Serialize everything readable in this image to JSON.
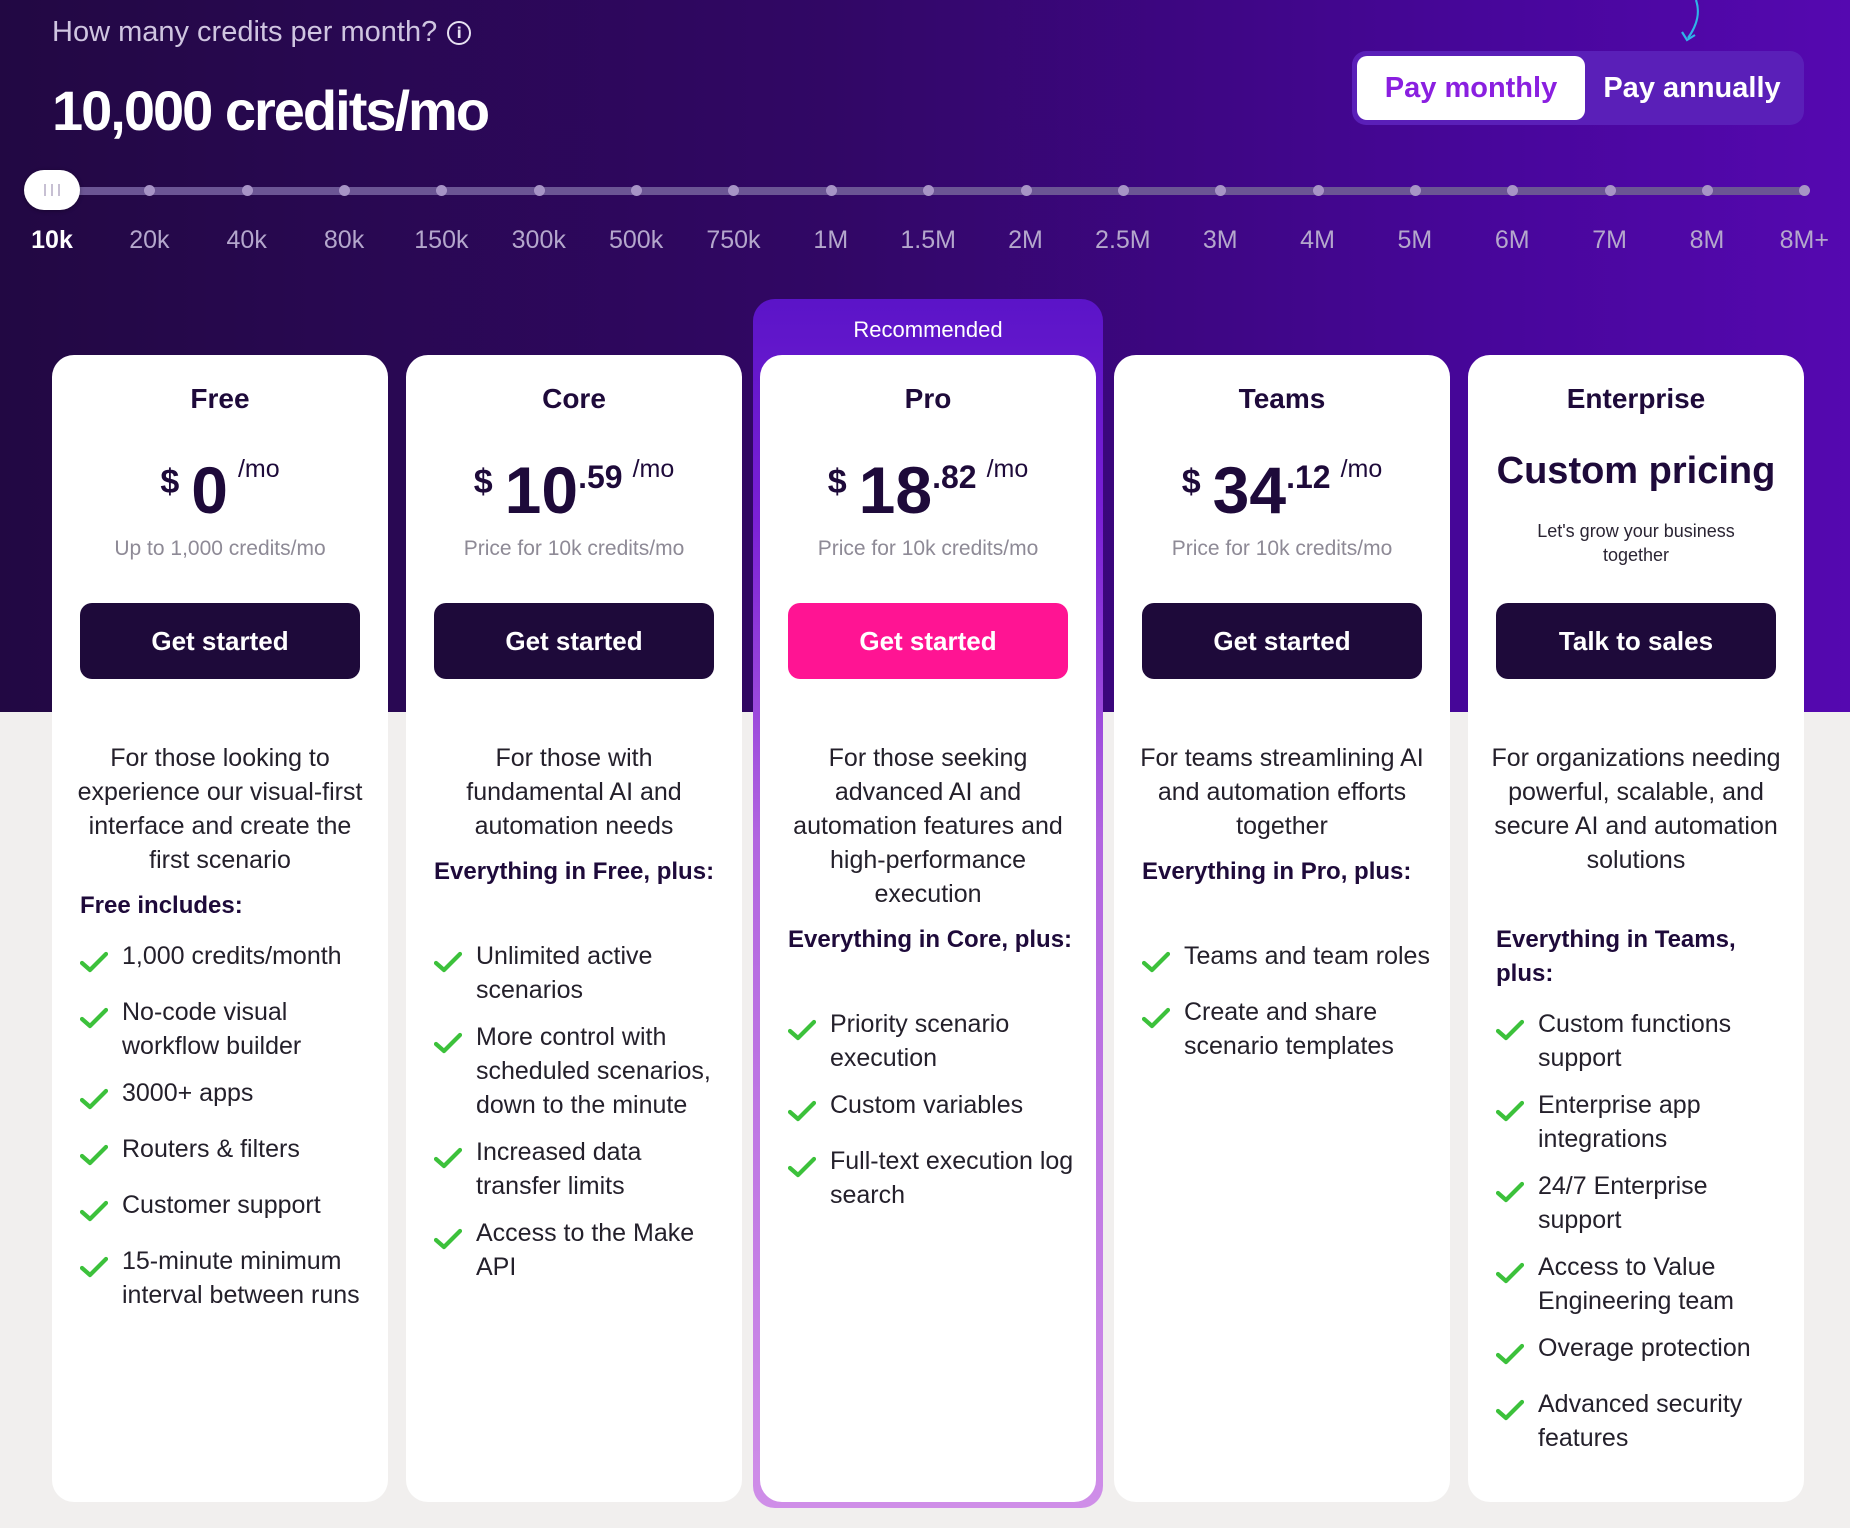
{
  "header": {
    "question": "How many credits per month?",
    "info_icon": "info-circle-icon",
    "selected_value": "10,000 credits/mo"
  },
  "billing": {
    "monthly_label": "Pay monthly",
    "annual_label": "Pay annually",
    "selected": "monthly"
  },
  "slider": {
    "labels": [
      "10k",
      "20k",
      "40k",
      "80k",
      "150k",
      "300k",
      "500k",
      "750k",
      "1M",
      "1.5M",
      "2M",
      "2.5M",
      "3M",
      "4M",
      "5M",
      "6M",
      "7M",
      "8M",
      "8M+"
    ],
    "selected_index": 0
  },
  "colors": {
    "accent_pink": "#ff1493",
    "accent_purple": "#8a1fe0",
    "check_green": "#3cc13b",
    "dark_navy": "#1e0a3a"
  },
  "plans": [
    {
      "name": "Free",
      "currency": "$",
      "price_int": "0",
      "price_dec": "",
      "per": "/mo",
      "note": "Up to 1,000 credits/mo",
      "cta": "Get started",
      "description": "For those looking to experience our visual-first interface and create the first scenario",
      "includes_title": "Free includes:",
      "features": [
        "1,000 credits/month",
        "No-code visual workflow builder",
        "3000+ apps",
        "Routers & filters",
        "Customer support",
        "15-minute minimum interval between runs"
      ]
    },
    {
      "name": "Core",
      "currency": "$",
      "price_int": "10",
      "price_dec": ".59",
      "per": "/mo",
      "note": "Price for 10k credits/mo",
      "cta": "Get started",
      "description": "For those with fundamental AI and automation needs",
      "includes_title": "Everything in Free, plus:",
      "features": [
        "Unlimited active scenarios",
        "More control with scheduled scenarios, down to the minute",
        "Increased data transfer limits",
        "Access to the Make API"
      ]
    },
    {
      "name": "Pro",
      "recommended_label": "Recommended",
      "currency": "$",
      "price_int": "18",
      "price_dec": ".82",
      "per": "/mo",
      "note": "Price for 10k credits/mo",
      "cta": "Get started",
      "description": "For those seeking advanced AI and automation features and high-performance execution",
      "includes_title": "Everything in Core, plus:",
      "features": [
        "Priority scenario execution",
        "Custom variables",
        "Full-text execution log search"
      ]
    },
    {
      "name": "Teams",
      "currency": "$",
      "price_int": "34",
      "price_dec": ".12",
      "per": "/mo",
      "note": "Price for 10k credits/mo",
      "cta": "Get started",
      "description": "For teams streamlining AI and automation efforts together",
      "includes_title": "Everything in Pro, plus:",
      "features": [
        "Teams and team roles",
        "Create and share scenario templates"
      ]
    },
    {
      "name": "Enterprise",
      "price_text": "Custom pricing",
      "note": "Let's grow your business together",
      "cta": "Talk to sales",
      "description": "For organizations needing powerful, scalable, and secure AI and automation solutions",
      "includes_title": "Everything in Teams, plus:",
      "features": [
        "Custom functions support",
        "Enterprise app integrations",
        "24/7 Enterprise support",
        "Access to Value Engineering team",
        "Overage protection",
        "Advanced security features"
      ]
    }
  ]
}
